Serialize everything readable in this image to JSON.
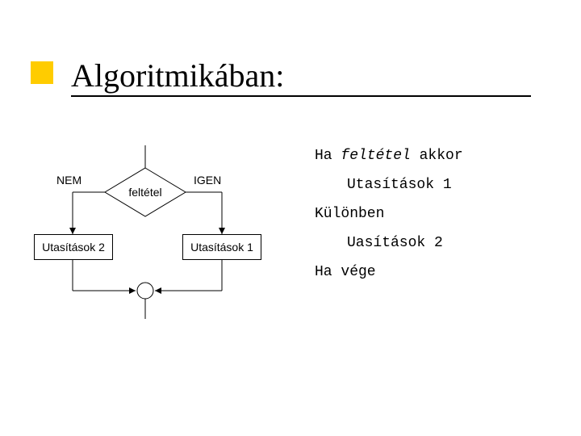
{
  "title": "Algoritmikában:",
  "flow": {
    "nem": "NEM",
    "igen": "IGEN",
    "condition": "feltétel",
    "instr1": "Utasítások 1",
    "instr2": "Utasítások 2"
  },
  "code": {
    "line1_a": "Ha ",
    "line1_b": "feltétel",
    "line1_c": " akkor",
    "line2": "Utasítások 1",
    "line3": "Különben",
    "line4": "Uasítások 2",
    "line5": "Ha vége"
  }
}
